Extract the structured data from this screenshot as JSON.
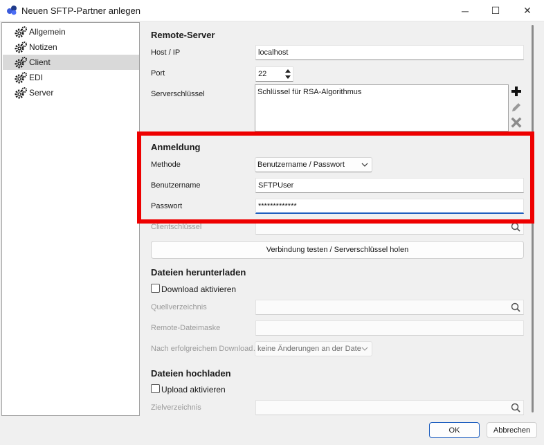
{
  "window": {
    "title": "Neuen SFTP-Partner anlegen",
    "minimize_glyph": "─",
    "maximize_glyph": "☐",
    "close_glyph": "✕"
  },
  "sidebar": {
    "items": [
      {
        "label": "Allgemein",
        "icon": "gears-icon"
      },
      {
        "label": "Notizen",
        "icon": "gears-icon"
      },
      {
        "label": "Client",
        "icon": "gears-icon",
        "selected": true
      },
      {
        "label": "EDI",
        "icon": "gears-icon"
      },
      {
        "label": "Server",
        "icon": "gears-icon"
      }
    ]
  },
  "remote": {
    "title": "Remote-Server",
    "host_label": "Host / IP",
    "host_value": "localhost",
    "port_label": "Port",
    "port_value": "22",
    "key_label": "Serverschlüssel",
    "key_value": "Schlüssel für RSA-Algorithmus"
  },
  "login": {
    "title": "Anmeldung",
    "method_label": "Methode",
    "method_value": "Benutzername / Passwort",
    "user_label": "Benutzername",
    "user_value": "SFTPUser",
    "password_label": "Passwort",
    "password_value": "*************",
    "client_key_label": "Clientschlüssel"
  },
  "test_button": "Verbindung testen / Serverschlüssel holen",
  "download": {
    "title": "Dateien herunterladen",
    "enable_label": "Download aktivieren",
    "source_label": "Quellverzeichnis",
    "source_value": "",
    "mask_label": "Remote-Dateimaske",
    "mask_value": "",
    "after_label": "Nach erfolgreichem Download…",
    "after_value": "keine Änderungen an der Date"
  },
  "upload": {
    "title": "Dateien hochladen",
    "enable_label": "Upload aktivieren",
    "target_label": "Zielverzeichnis",
    "target_value": ""
  },
  "buttons": {
    "ok": "OK",
    "cancel": "Abbrechen"
  },
  "colors": {
    "highlight": "#ee0000",
    "focus": "#1f5fbf"
  }
}
